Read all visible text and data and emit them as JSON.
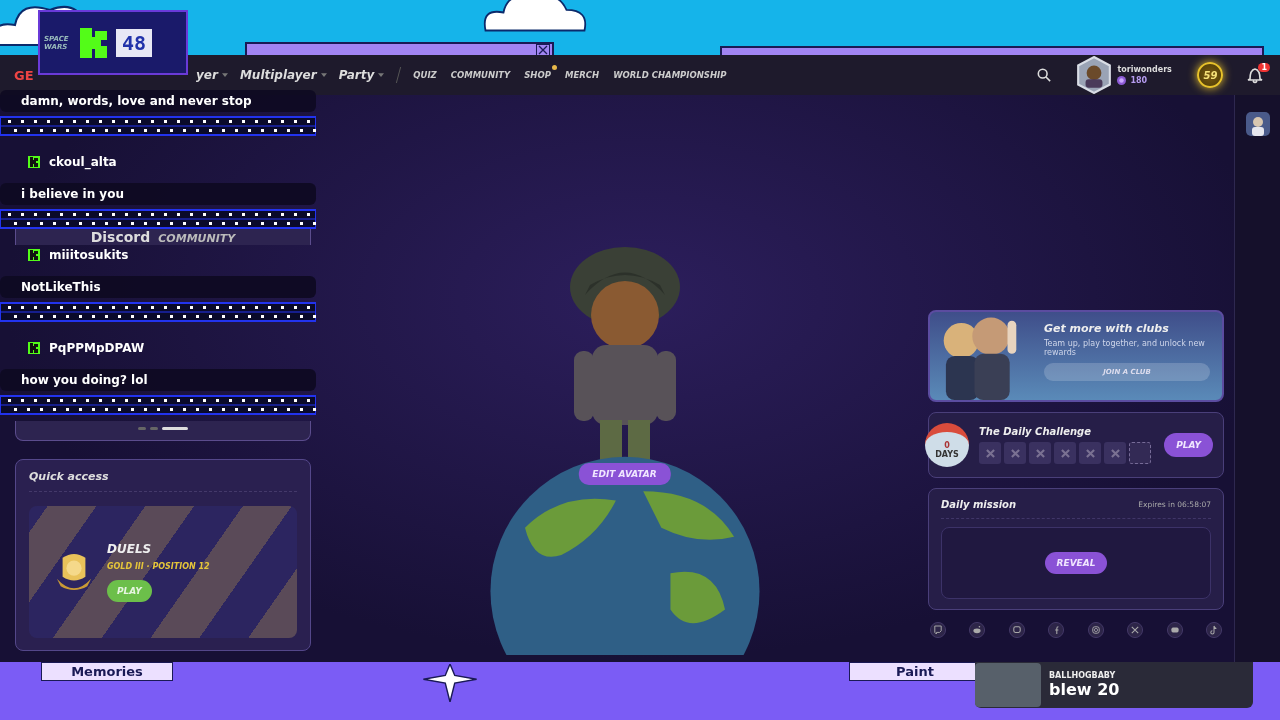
{
  "stream_overlay": {
    "badge": "48",
    "caption": "SPACE WARS"
  },
  "nav": {
    "logo": "GE",
    "menus": [
      {
        "label": "yer"
      },
      {
        "label": "Multiplayer"
      },
      {
        "label": "Party"
      }
    ],
    "links": [
      {
        "label": "QUIZ",
        "dot": false
      },
      {
        "label": "COMMUNITY",
        "dot": false
      },
      {
        "label": "SHOP",
        "dot": true
      },
      {
        "label": "MERCH",
        "dot": false
      },
      {
        "label": "WORLD CHAMPIONSHIP",
        "dot": false
      }
    ]
  },
  "account": {
    "username": "toriwonders",
    "coins": "180",
    "level": "59",
    "notifications": "1"
  },
  "chat": [
    {
      "kind": "message",
      "text": "damn, words, love and never stop"
    },
    {
      "kind": "divider"
    },
    {
      "kind": "user",
      "text": "ckoul_alta"
    },
    {
      "kind": "message",
      "text": "i believe in you"
    },
    {
      "kind": "divider"
    },
    {
      "kind": "user",
      "text": "miiitosukits"
    },
    {
      "kind": "message",
      "text": "NotLikeThis"
    },
    {
      "kind": "divider"
    },
    {
      "kind": "user",
      "text": "PqPPMpDPAW"
    },
    {
      "kind": "message",
      "text": "how you doing? lol"
    },
    {
      "kind": "divider"
    }
  ],
  "promo": {
    "title": "Discord",
    "subtitle": "COMMUNITY",
    "slides": [
      {
        "selected": false
      },
      {
        "selected": false
      },
      {
        "selected": true
      }
    ]
  },
  "quick_access": {
    "title": "Quick access",
    "mode": "DUELS",
    "rank": "GOLD III · POSITION 12",
    "button": "PLAY"
  },
  "avatar": {
    "button": "EDIT AVATAR"
  },
  "clubs": {
    "title": "Get more with clubs",
    "text": "Team up, play together, and unlock new rewards",
    "button": "JOIN A CLUB"
  },
  "daily_challenge": {
    "title": "The Daily Challenge",
    "streak": "0",
    "streak_unit": "DAYS",
    "days": [
      {
        "missed": true
      },
      {
        "missed": true
      },
      {
        "missed": true
      },
      {
        "missed": true
      },
      {
        "missed": true
      },
      {
        "missed": true
      },
      {
        "missed": false
      }
    ],
    "button": "PLAY"
  },
  "daily_mission": {
    "title": "Daily mission",
    "expires": "Expires in 06:58:07",
    "button": "REVEAL"
  },
  "social": [
    {
      "kind": "twitch"
    },
    {
      "kind": "reddit"
    },
    {
      "kind": "discord"
    },
    {
      "kind": "facebook"
    },
    {
      "kind": "instagram"
    },
    {
      "kind": "x"
    },
    {
      "kind": "youtube"
    },
    {
      "kind": "tiktok"
    }
  ],
  "stream_bar": {
    "labels": [
      "Memories",
      "Paint"
    ],
    "alert": {
      "user": "BALLHOGBABY",
      "text": "blew 20"
    }
  }
}
